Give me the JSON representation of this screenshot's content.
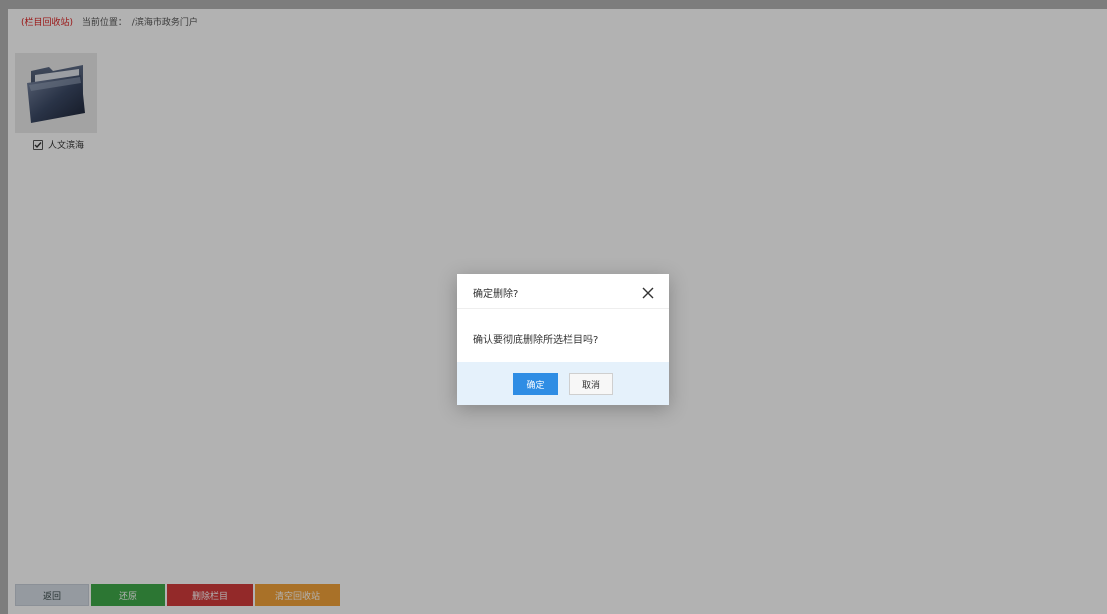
{
  "header": {
    "recycle_tag": "(栏目回收站)",
    "location_label": "当前位置：",
    "location_path": "/滨海市政务门户"
  },
  "folders": [
    {
      "name": "人文滨海",
      "checked": true,
      "icon": "folder-icon"
    }
  ],
  "toolbar": {
    "back_label": "返回",
    "restore_label": "还原",
    "delete_label": "删除栏目",
    "clear_label": "清空回收站"
  },
  "dialog": {
    "title": "确定删除?",
    "message": "确认要彻底删除所选栏目吗?",
    "ok_label": "确定",
    "cancel_label": "取消",
    "close_icon": "close-icon"
  },
  "colors": {
    "recycle_tag": "#dd2222",
    "restore": "#40a94a",
    "delete": "#d33c3c",
    "clear": "#f2a33a",
    "ok": "#2f8de4",
    "dialog_footer": "#e5f1fb"
  }
}
